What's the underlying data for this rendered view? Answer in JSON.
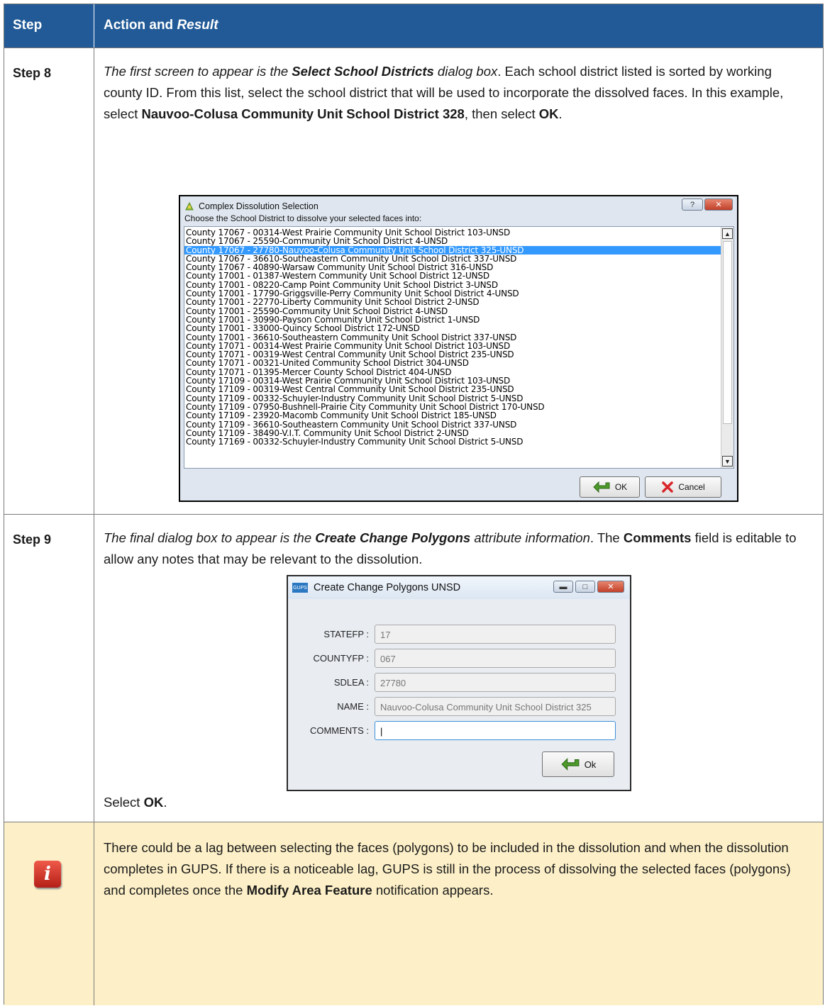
{
  "header": {
    "step_label": "Step",
    "action_label": "Action and ",
    "result_label": "Result"
  },
  "step8": {
    "label": "Step 8",
    "text_italic_1": "The first screen to appear is the ",
    "text_bold_italic_1": "Select School Districts",
    "text_italic_2": " dialog box",
    "text_3": ". Each school district listed is sorted by working county ID. From this list, select the school district that will be used to incorporate the dissolved faces. In this example, select ",
    "text_bold_2": "Nauvoo-Colusa Community Unit School District 328",
    "text_4": ", then select ",
    "text_bold_3": "OK",
    "text_5": ".",
    "dialog": {
      "title": "Complex Dissolution Selection",
      "prompt": "Choose the School District to dissolve your selected faces into:",
      "help_btn": "?",
      "close_btn": "✕",
      "items": [
        "County 17067 - 00314-West Prairie Community Unit School District 103-UNSD",
        "County 17067 - 25590-Community Unit School District 4-UNSD",
        "County 17067 - 27780-Nauvoo-Colusa Community Unit School District 325-UNSD",
        "County 17067 - 36610-Southeastern Community Unit School District 337-UNSD",
        "County 17067 - 40890-Warsaw Community Unit School District 316-UNSD",
        "County 17001 - 01387-Western Community Unit School District 12-UNSD",
        "County 17001 - 08220-Camp Point Community Unit School District 3-UNSD",
        "County 17001 - 17790-Griggsville-Perry Community Unit School District 4-UNSD",
        "County 17001 - 22770-Liberty Community Unit School District 2-UNSD",
        "County 17001 - 25590-Community Unit School District 4-UNSD",
        "County 17001 - 30990-Payson Community Unit School District 1-UNSD",
        "County 17001 - 33000-Quincy School District 172-UNSD",
        "County 17001 - 36610-Southeastern Community Unit School District 337-UNSD",
        "County 17071 - 00314-West Prairie Community Unit School District 103-UNSD",
        "County 17071 - 00319-West Central Community Unit School District 235-UNSD",
        "County 17071 - 00321-United Community School District 304-UNSD",
        "County 17071 - 01395-Mercer County School District 404-UNSD",
        "County 17109 - 00314-West Prairie Community Unit School District 103-UNSD",
        "County 17109 - 00319-West Central Community Unit School District 235-UNSD",
        "County 17109 - 00332-Schuyler-Industry Community Unit School District 5-UNSD",
        "County 17109 - 07950-Bushnell-Prairie City Community Unit School District 170-UNSD",
        "County 17109 - 23920-Macomb Community Unit School District 185-UNSD",
        "County 17109 - 36610-Southeastern Community Unit School District 337-UNSD",
        "County 17109 - 38490-V.I.T. Community Unit School District 2-UNSD",
        "County 17169 - 00332-Schuyler-Industry Community Unit School District 5-UNSD"
      ],
      "selected_index": 2,
      "ok_label": "OK",
      "cancel_label": "Cancel"
    }
  },
  "step9": {
    "label": "Step 9",
    "text_italic_1": "The final dialog box to appear is the ",
    "text_bold_italic_1": "Create Change Polygons",
    "text_italic_2": " attribute information",
    "text_3": ". The ",
    "text_bold_2": "Comments",
    "text_4": " field is editable to allow any notes that may be relevant to the dissolution.",
    "dialog": {
      "title": "Create Change Polygons UNSD",
      "app_icon": "GUPS",
      "fields": [
        {
          "label": "STATEFP :",
          "value": "17"
        },
        {
          "label": "COUNTYFP :",
          "value": "067"
        },
        {
          "label": "SDLEA :",
          "value": "27780"
        },
        {
          "label": "NAME :",
          "value": "Nauvoo-Colusa Community Unit School District 325"
        },
        {
          "label": "COMMENTS :",
          "value": "|"
        }
      ],
      "ok_label": "Ok"
    },
    "select_text": "Select ",
    "select_bold": "OK",
    "select_end": "."
  },
  "note": {
    "icon": "i",
    "text_1": "There could be a lag between selecting the faces (polygons) to be included in the dissolution and when the dissolution completes in GUPS. If there is a noticeable lag, GUPS is still in the process of dissolving the selected faces (polygons) and completes once the ",
    "text_bold": "Modify Area Feature",
    "text_2": " notification appears."
  }
}
